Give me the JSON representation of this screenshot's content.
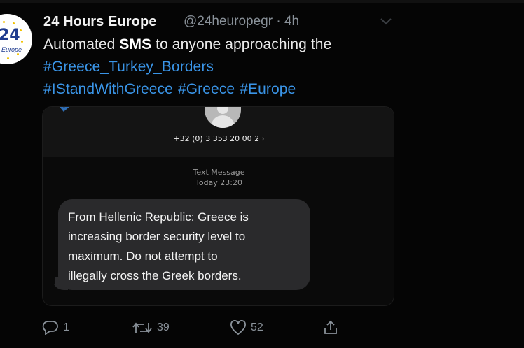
{
  "tweet": {
    "author_name": "24 Hours Europe",
    "handle": "@24heuropegr",
    "separator": "·",
    "time": "4h",
    "text_pre": "Automated ",
    "text_bold": "SMS",
    "text_post": " to anyone approaching the",
    "hashtags_line2": [
      "#Greece_Turkey_Borders"
    ],
    "hashtags_line3": [
      "#IStandWithGreece",
      "#Greece",
      "#Europe"
    ],
    "avatar": {
      "number": "24",
      "brand": "Europe"
    }
  },
  "sms": {
    "phone_number": "+32 (0) 3 353 20 00 2",
    "phone_chevron": "›",
    "label": "Text Message",
    "timestamp": "Today 23:20",
    "message": "From Hellenic Republic: Greece is\nincreasing border security level to\nmaximum. Do not attempt to\nillegally cross the Greek borders."
  },
  "actions": {
    "reply_count": "1",
    "retweet_count": "39",
    "like_count": "52"
  },
  "icons": {
    "reply": "reply-icon",
    "retweet": "retweet-icon",
    "like": "heart-icon",
    "share": "share-icon",
    "more": "chevron-down-icon"
  },
  "colors": {
    "background": "#050505",
    "hashtag": "#3a95e8",
    "muted": "#8a929a",
    "bubble": "#2a2a2c"
  }
}
